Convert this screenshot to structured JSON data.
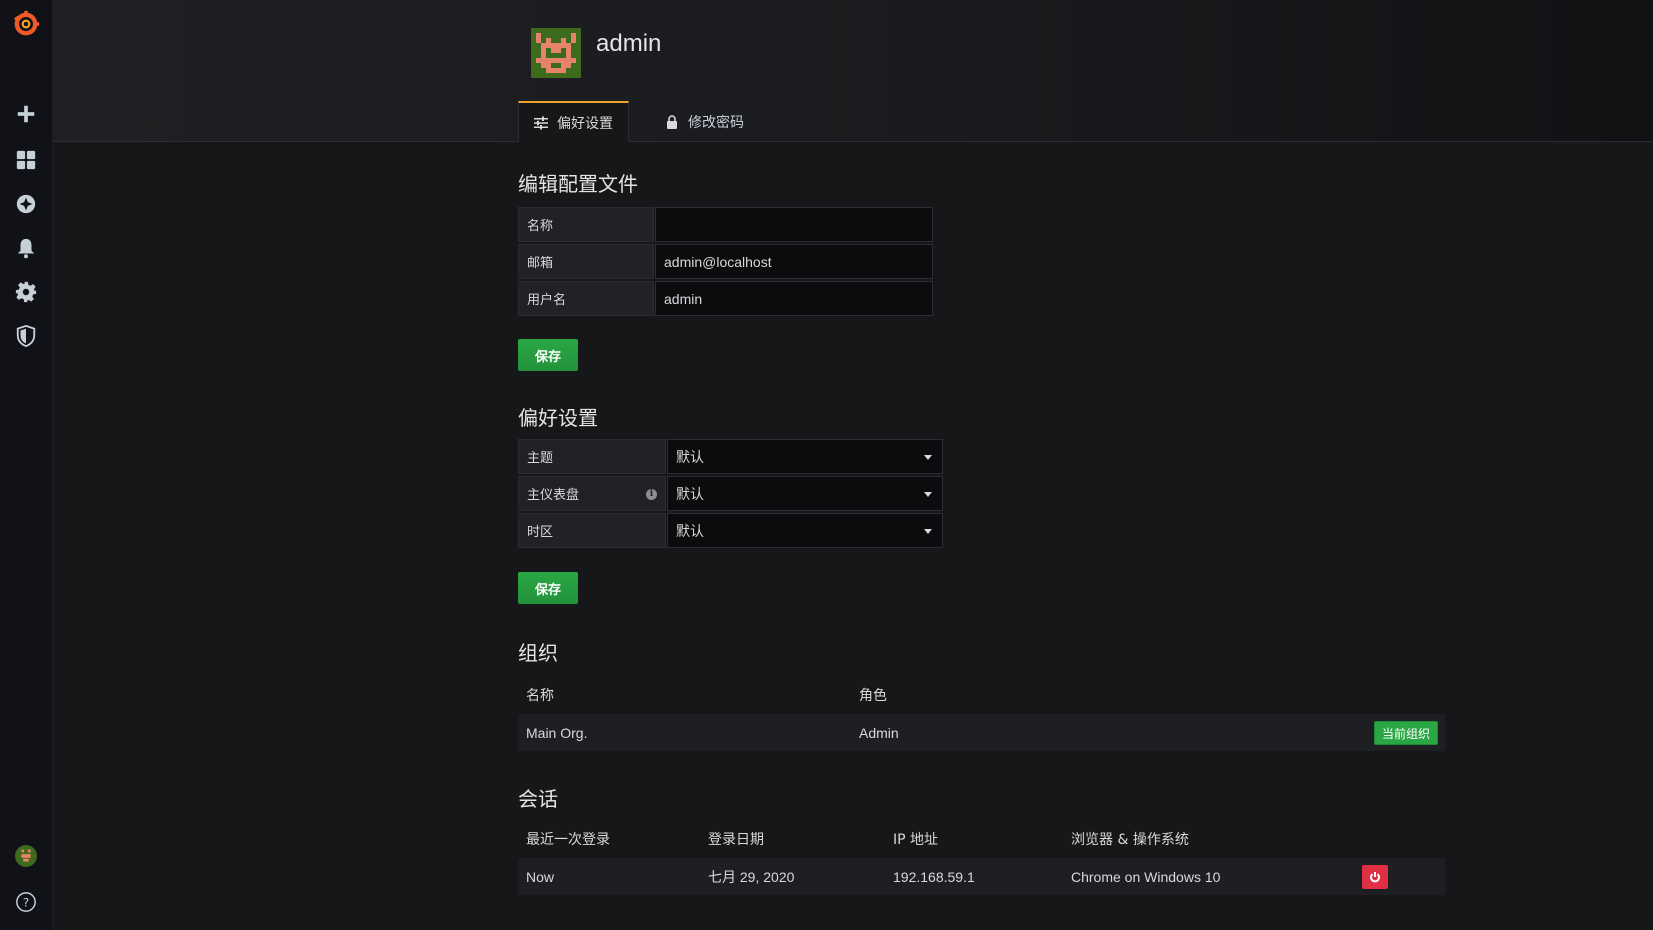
{
  "user": {
    "name": "admin"
  },
  "tabs": [
    {
      "label": "偏好设置",
      "icon": "sliders-icon"
    },
    {
      "label": "修改密码",
      "icon": "lock-icon"
    }
  ],
  "profile": {
    "title": "编辑配置文件",
    "fields": [
      {
        "label": "名称",
        "value": ""
      },
      {
        "label": "邮箱",
        "value": "admin@localhost"
      },
      {
        "label": "用户名",
        "value": "admin"
      }
    ],
    "save_label": "保存"
  },
  "preferences": {
    "title": "偏好设置",
    "fields": [
      {
        "label": "主题",
        "value": "默认"
      },
      {
        "label": "主仪表盘",
        "value": "默认"
      },
      {
        "label": "时区",
        "value": "默认"
      }
    ],
    "save_label": "保存"
  },
  "orgs": {
    "title": "组织",
    "headers": [
      "名称",
      "角色"
    ],
    "rows": [
      {
        "name": "Main Org.",
        "role": "Admin",
        "badge": "当前组织"
      }
    ]
  },
  "sessions": {
    "title": "会话",
    "headers": [
      "最近一次登录",
      "登录日期",
      "IP 地址",
      "浏览器 & 操作系统"
    ],
    "rows": [
      {
        "last": "Now",
        "date": "七月 29, 2020",
        "ip": "192.168.59.1",
        "browser": "Chrome on Windows 10"
      }
    ]
  },
  "colors": {
    "accent": "#f0a02c",
    "primary_green": "#2aa744",
    "danger_red": "#e02f44"
  },
  "sidebar": {
    "icons": [
      "grafana-logo-icon",
      "plus-icon",
      "dashboards-icon",
      "explore-icon",
      "bell-icon",
      "gear-icon",
      "shield-icon",
      "user-avatar",
      "help-icon"
    ]
  }
}
